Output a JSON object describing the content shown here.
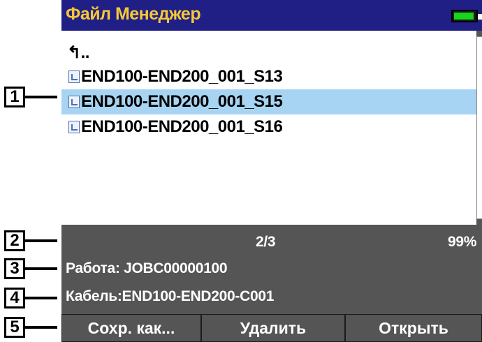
{
  "callouts": [
    "1",
    "2",
    "3",
    "4",
    "5"
  ],
  "header": {
    "title": "Файл Менеджер",
    "battery_icon": "battery-full-icon",
    "battery_color": "#17d41c"
  },
  "file_list": {
    "parent": "↰..",
    "items": [
      {
        "name": "END100-END200_001_S13",
        "icon": "document-icon",
        "selected": false
      },
      {
        "name": "END100-END200_001_S15",
        "icon": "document-icon",
        "selected": true
      },
      {
        "name": "END100-END200_001_S16",
        "icon": "document-icon",
        "selected": false
      }
    ]
  },
  "status": {
    "position": "2/3",
    "battery_percent": "99%"
  },
  "job": "Работа: JOBC00000100",
  "cable": "Кабель:END100-END200-C001",
  "buttons": {
    "save_as": "Сохр. как...",
    "delete": "Удалить",
    "open": "Открыть"
  },
  "colors": {
    "title_bar": "#1f1f86",
    "title_text": "#f6c836",
    "selection": "#a8d4f3",
    "panel": "#555555"
  }
}
